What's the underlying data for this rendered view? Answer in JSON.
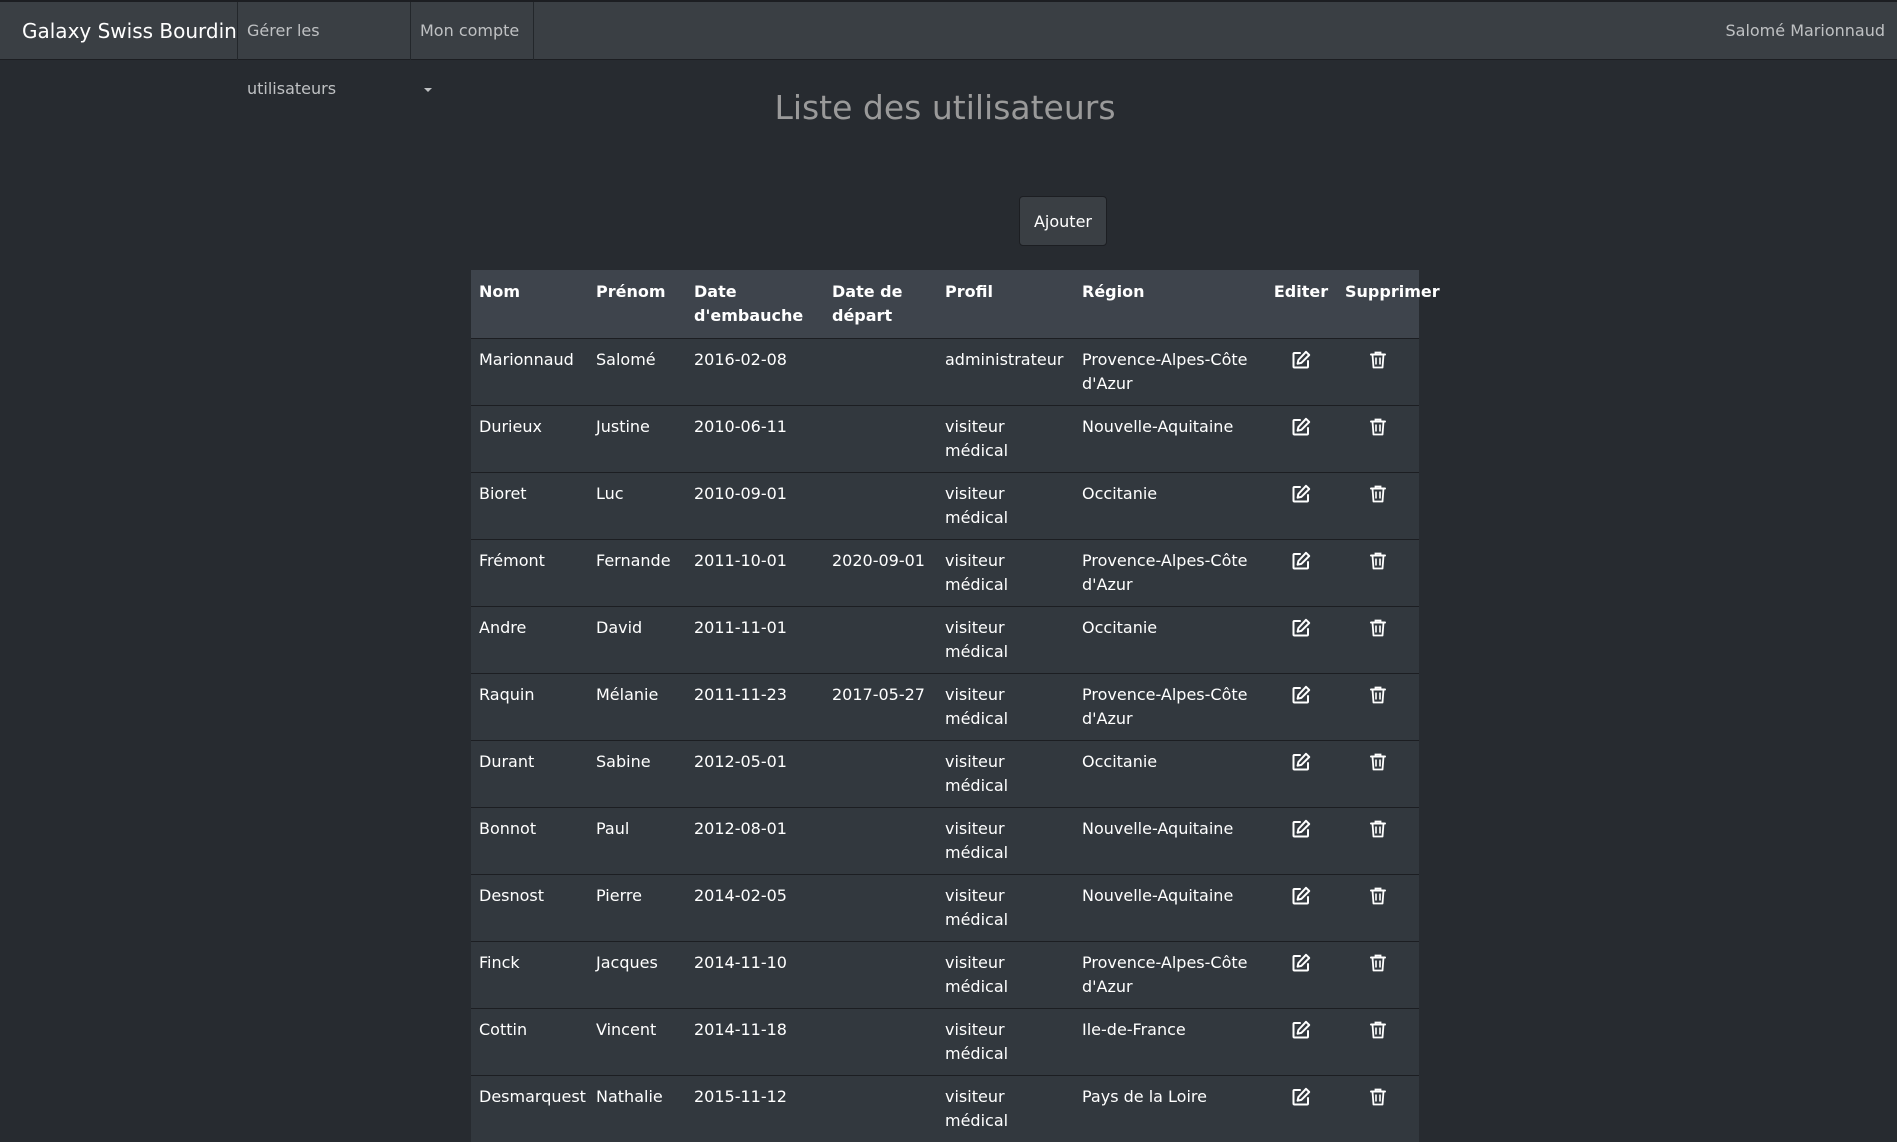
{
  "navbar": {
    "brand": "Galaxy Swiss Bourdin",
    "links": [
      "Gérer les utilisateurs",
      "Mon compte"
    ],
    "user_name": "Salomé Marionnaud"
  },
  "main": {
    "title": "Liste des utilisateurs",
    "add_label": "Ajouter"
  },
  "table": {
    "columns": [
      "Nom",
      "Prénom",
      "Date d'embauche",
      "Date de départ",
      "Profil",
      "Région",
      "Editer",
      "Supprimer"
    ],
    "rows": [
      [
        "Marionnaud",
        "Salomé",
        "2016-02-08",
        "",
        "administrateur",
        "Provence-Alpes-Côte d'Azur"
      ],
      [
        "Durieux",
        "Justine",
        "2010-06-11",
        "",
        "visiteur médical",
        "Nouvelle-Aquitaine"
      ],
      [
        "Bioret",
        "Luc",
        "2010-09-01",
        "",
        "visiteur médical",
        "Occitanie"
      ],
      [
        "Frémont",
        "Fernande",
        "2011-10-01",
        "2020-09-01",
        "visiteur médical",
        "Provence-Alpes-Côte d'Azur"
      ],
      [
        "Andre",
        "David",
        "2011-11-01",
        "",
        "visiteur médical",
        "Occitanie"
      ],
      [
        "Raquin",
        "Mélanie",
        "2011-11-23",
        "2017-05-27",
        "visiteur médical",
        "Provence-Alpes-Côte d'Azur"
      ],
      [
        "Durant",
        "Sabine",
        "2012-05-01",
        "",
        "visiteur médical",
        "Occitanie"
      ],
      [
        "Bonnot",
        "Paul",
        "2012-08-01",
        "",
        "visiteur médical",
        "Nouvelle-Aquitaine"
      ],
      [
        "Desnost",
        "Pierre",
        "2014-02-05",
        "",
        "visiteur médical",
        "Nouvelle-Aquitaine"
      ],
      [
        "Finck",
        "Jacques",
        "2014-11-10",
        "",
        "visiteur médical",
        "Provence-Alpes-Côte d'Azur"
      ],
      [
        "Cottin",
        "Vincent",
        "2014-11-18",
        "",
        "visiteur médical",
        "Ile-de-France"
      ],
      [
        "Desmarquest",
        "Nathalie",
        "2015-11-12",
        "",
        "visiteur médical",
        "Pays de la Loire"
      ]
    ],
    "edit_icon": "edit-icon",
    "delete_icon": "trash-icon"
  },
  "colors": {
    "background": "#272b30",
    "navbar": "#3a3f44",
    "table_header": "#3e444c",
    "table_row": "#32383e",
    "title": "#9a9a9a"
  }
}
